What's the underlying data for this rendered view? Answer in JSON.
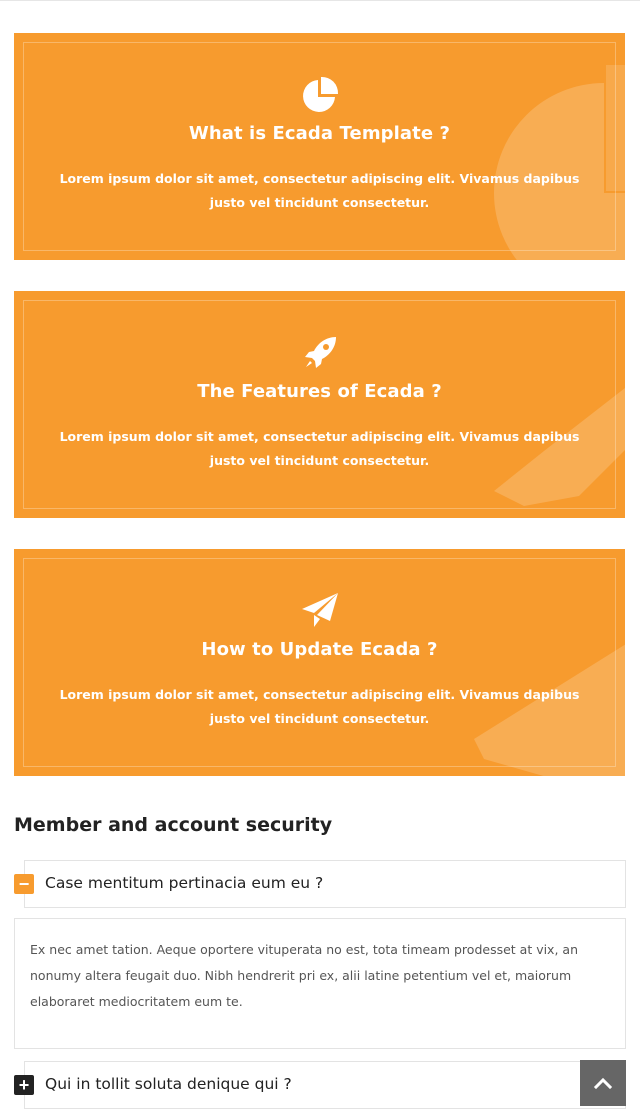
{
  "cards": [
    {
      "icon": "pie-chart-icon",
      "title": "What is Ecada Template ?",
      "text": "Lorem ipsum dolor sit amet, consectetur adipiscing elit. Vivamus dapibus justo vel tincidunt consectetur."
    },
    {
      "icon": "rocket-icon",
      "title": "The Features of Ecada ?",
      "text": "Lorem ipsum dolor sit amet, consectetur adipiscing elit. Vivamus dapibus justo vel tincidunt consectetur."
    },
    {
      "icon": "paper-plane-icon",
      "title": "How to Update Ecada ?",
      "text": "Lorem ipsum dolor sit amet, consectetur adipiscing elit. Vivamus dapibus justo vel tincidunt consectetur."
    }
  ],
  "faq": {
    "heading": "Member and account security",
    "items": [
      {
        "toggle": "−",
        "title": "Case mentitum pertinacia eum eu ?",
        "expanded": true,
        "body": "Ex nec amet tation. Aeque oportere vituperata no est, tota timeam prodesset at vix, an nonumy altera feugait duo. Nibh hendrerit pri ex, alii latine petentium vel et, maiorum elaboraret mediocritatem eum te."
      },
      {
        "toggle": "+",
        "title": "Qui in tollit soluta denique qui ?",
        "expanded": false
      }
    ]
  },
  "colors": {
    "card_orange": "#f79b2e",
    "toggle_active": "#f79b2e",
    "toggle_inactive": "#222222",
    "scroll_button": "#666666"
  },
  "scroll_top": {
    "icon": "chevron-up-icon"
  }
}
